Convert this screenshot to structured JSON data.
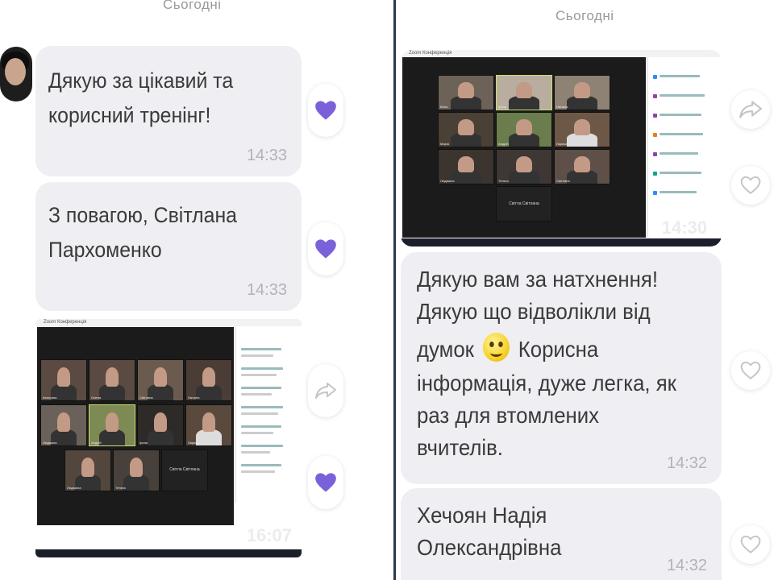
{
  "left_panel": {
    "date_label": "Сьогодні",
    "messages": [
      {
        "text_lines": [
          "Дякую за цікавий та",
          "корисний тренінг!"
        ],
        "time": "14:33"
      },
      {
        "text_lines": [
          "З повагою, Світлана",
          "Пархоменко"
        ],
        "time": "14:33"
      }
    ],
    "screenshot": {
      "title": "Zoom Конференція",
      "tile_blank_label": "Світла Світлана",
      "timestamp": "16:07"
    }
  },
  "right_panel": {
    "date_label": "Сьогодні",
    "screenshot": {
      "title": "Zoom Конференція",
      "tile_blank_label": "Світла Світлана",
      "timestamp": "14:30"
    },
    "messages": [
      {
        "text_lines": [
          "Дякую вам за натхнення!",
          "Дякую що відволікли від"
        ],
        "line3_before": "думок",
        "line3_after": "Корисна",
        "text_lines_rest": [
          "інформація, дуже легка, як",
          "раз для втомлених",
          "вчителів."
        ],
        "time": "14:32"
      },
      {
        "text_lines": [
          "Хечоян Надія",
          "Олександрівна"
        ],
        "time": "14:32"
      }
    ]
  },
  "colors": {
    "bubble": "#efeef2",
    "heart_filled": "#7b61d9",
    "divider": "#2b3a4a",
    "meta_text": "#b3b3b6"
  },
  "icons": [
    "heart-filled-icon",
    "heart-outline-icon",
    "share-icon",
    "smiley-emoji-icon"
  ]
}
